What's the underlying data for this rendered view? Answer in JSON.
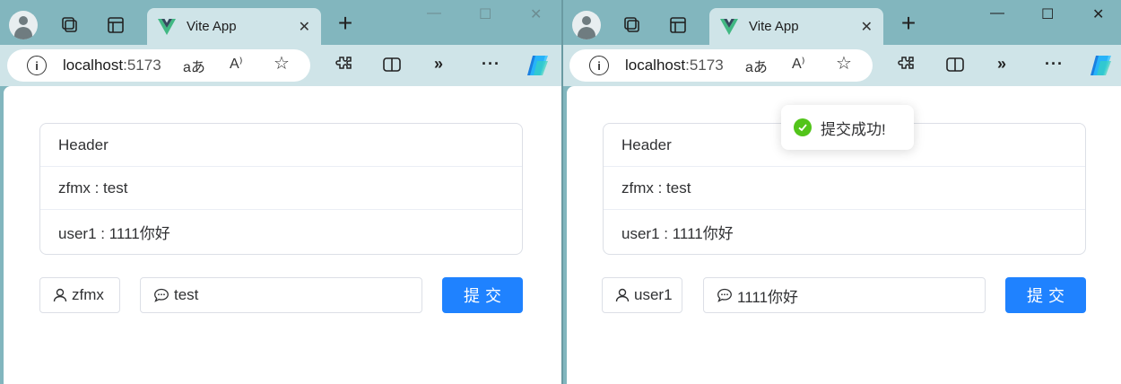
{
  "windows": [
    {
      "tab_title": "Vite App",
      "url_host": "localhost",
      "url_port": ":5173",
      "list": {
        "header": "Header",
        "rows": [
          "zfmx : test",
          "user1 : 1111你好"
        ]
      },
      "name_input": "zfmx",
      "message_input": "test",
      "submit_label": "提交",
      "toast": null
    },
    {
      "tab_title": "Vite App",
      "url_host": "localhost",
      "url_port": ":5173",
      "list": {
        "header": "Header",
        "rows": [
          "zfmx : test",
          "user1 : 1111你好"
        ]
      },
      "name_input": "user1",
      "message_input": "1111你好",
      "submit_label": "提交",
      "toast": "提交成功!"
    }
  ],
  "colors": {
    "accent": "#1f82ff",
    "success": "#52c41a",
    "frame": "#82b6be",
    "tab_active": "#cfe4e8"
  },
  "icons": [
    "profile-icon",
    "workspaces-icon",
    "tab-actions-icon",
    "vue-logo-icon",
    "close-icon",
    "new-tab-icon",
    "minimize-icon",
    "maximize-icon",
    "window-close-icon",
    "info-icon",
    "read-aloud-icon",
    "favorite-icon",
    "extensions-icon",
    "split-screen-icon",
    "chevron-more-icon",
    "more-icon",
    "copilot-icon",
    "user-icon",
    "chat-icon",
    "success-icon"
  ]
}
